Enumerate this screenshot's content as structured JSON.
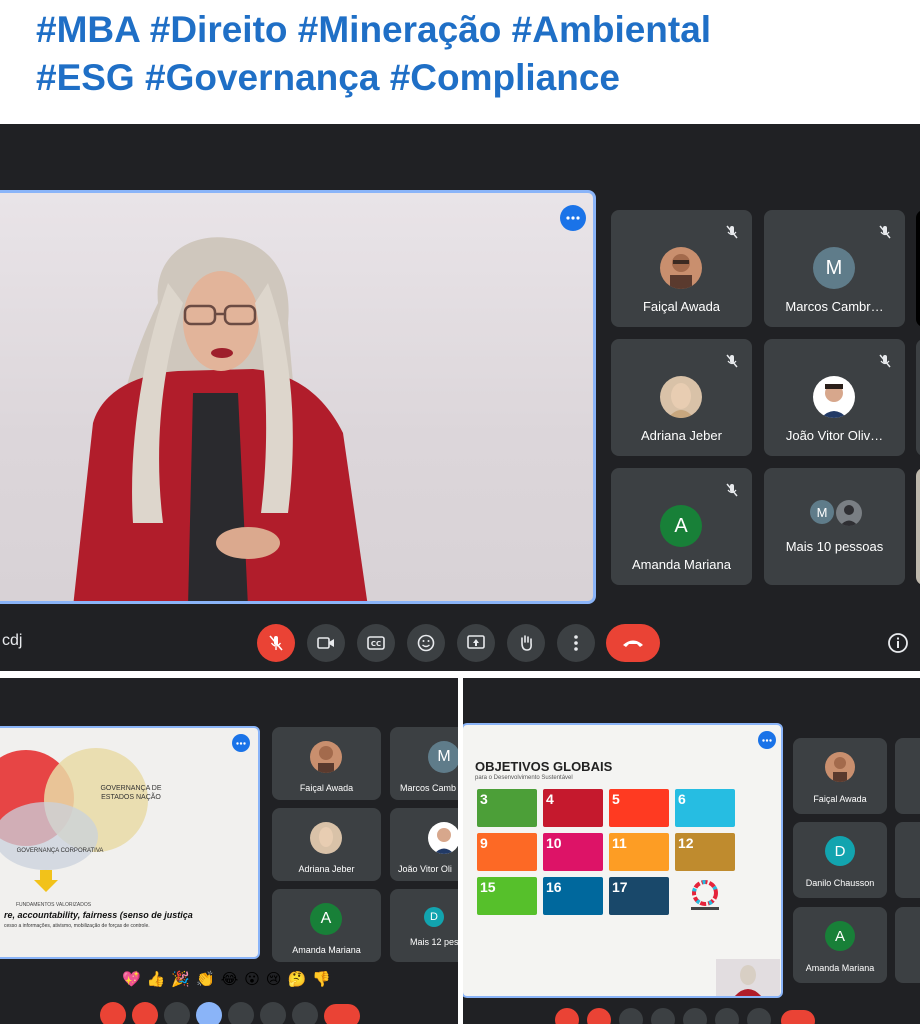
{
  "header": {
    "line1": "#MBA #Direito #Mineração #Ambiental",
    "line2": "#ESG #Governança #Compliance"
  },
  "top_meeting": {
    "meeting_code": "cdj",
    "participants": [
      {
        "name": "Faiçal Awada"
      },
      {
        "name": "Marcos Cambr…",
        "initial": "M"
      },
      {
        "name": "Adriana Jeber"
      },
      {
        "name": "João Vitor Oliv…"
      },
      {
        "name": "Amanda Mariana",
        "initial": "A"
      }
    ],
    "more_people": {
      "label": "Mais 10 pessoas",
      "initial": "M"
    }
  },
  "bottom_left_meeting": {
    "participants": [
      {
        "name": "Faiçal Awada"
      },
      {
        "name": "Marcos Camb"
      },
      {
        "name": "Adriana Jeber"
      },
      {
        "name": "João Vitor Oli"
      },
      {
        "name": "Amanda Mariana",
        "initial": "A"
      }
    ],
    "more_people": {
      "label": "Mais 12 pes",
      "initial": "D"
    },
    "slide": {
      "label_governanca_estados": "GOVERNANÇA DE ESTADOS NAÇÃO",
      "label_governanca_corporativa": "GOVERNANÇA CORPORATIVA",
      "fundamentos": "FUNDAMENTOS VALORIZADOS",
      "main_text": "re, accountability, fairness (senso de justiça",
      "sub_text": "cesso a informações, ativismo, mobilização de forças de controle."
    },
    "emojis": "💖👍🎉👏😂😮😢🤔👎"
  },
  "bottom_right_meeting": {
    "participants": [
      {
        "name": "Faiçal Awada"
      },
      {
        "name": "Danilo Chausson",
        "initial": "D"
      },
      {
        "name": "Amanda Mariana",
        "initial": "A"
      }
    ],
    "slide": {
      "title": "OBJETIVOS GLOBAIS",
      "subtitle": "para o Desenvolvimento Sustentável",
      "sdg_numbers": [
        "3",
        "4",
        "5",
        "6",
        "9",
        "10",
        "11",
        "12",
        "15",
        "16",
        "17"
      ]
    }
  }
}
